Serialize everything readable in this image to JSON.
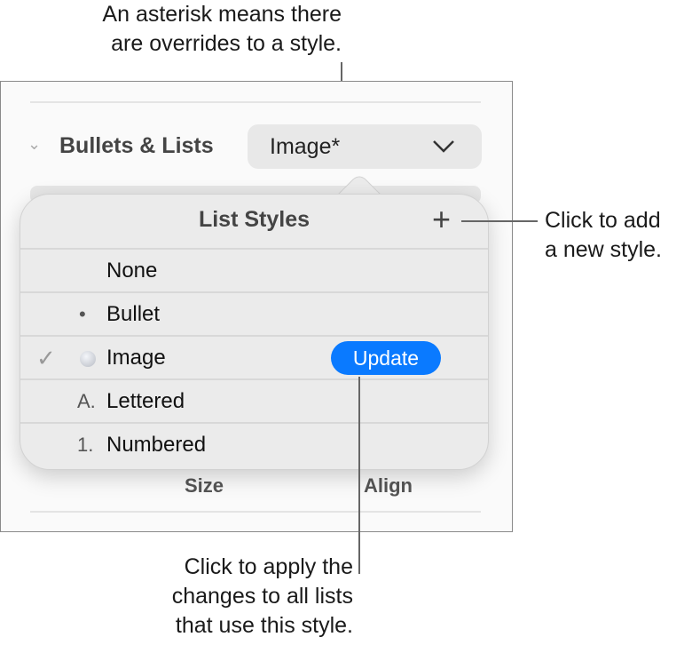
{
  "callouts": {
    "top": [
      "An asterisk means there",
      "are overrides to a style."
    ],
    "right": [
      "Click to add",
      "a new style."
    ],
    "bottom": [
      "Click to apply the",
      "changes to all lists",
      "that use this style."
    ]
  },
  "section": {
    "title": "Bullets & Lists",
    "style_value": "Image*"
  },
  "popover": {
    "title": "List Styles",
    "add_icon": "plus-icon",
    "items": [
      {
        "marker": "",
        "label": "None"
      },
      {
        "marker": "•",
        "label": "Bullet"
      },
      {
        "marker": "image-bullet",
        "label": "Image",
        "selected": true
      },
      {
        "marker": "A.",
        "label": "Lettered"
      },
      {
        "marker": "1.",
        "label": "Numbered"
      }
    ],
    "update_label": "Update"
  },
  "footer": {
    "size_label": "Size",
    "align_label": "Align"
  },
  "colors": {
    "accent": "#0a7aff"
  }
}
